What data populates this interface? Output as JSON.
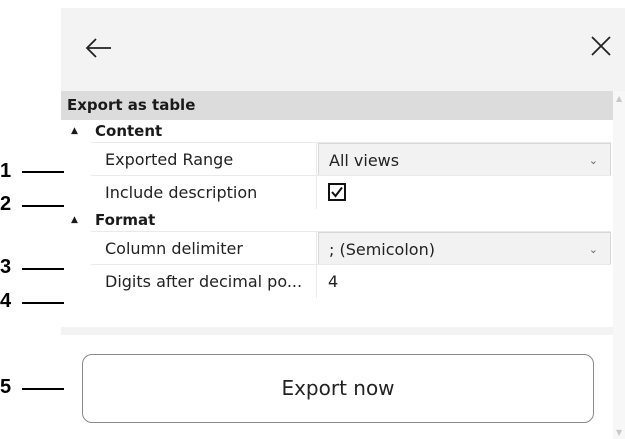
{
  "panel": {
    "title": "Export as table",
    "sections": [
      {
        "label": "Content",
        "properties": [
          {
            "name": "Exported Range",
            "value": "All views"
          },
          {
            "name": "Include description",
            "checked": true
          }
        ]
      },
      {
        "label": "Format",
        "properties": [
          {
            "name": "Column delimiter",
            "value": "; (Semicolon)"
          },
          {
            "name": "Digits after decimal po...",
            "value": "4"
          }
        ]
      }
    ],
    "export_button": "Export now"
  },
  "icons": {
    "back": "arrow-left-icon",
    "close": "close-icon",
    "chevron": "chevron-down-icon",
    "triangle": "expanded-triangle-icon"
  },
  "callouts": [
    "1",
    "2",
    "3",
    "4",
    "5"
  ]
}
